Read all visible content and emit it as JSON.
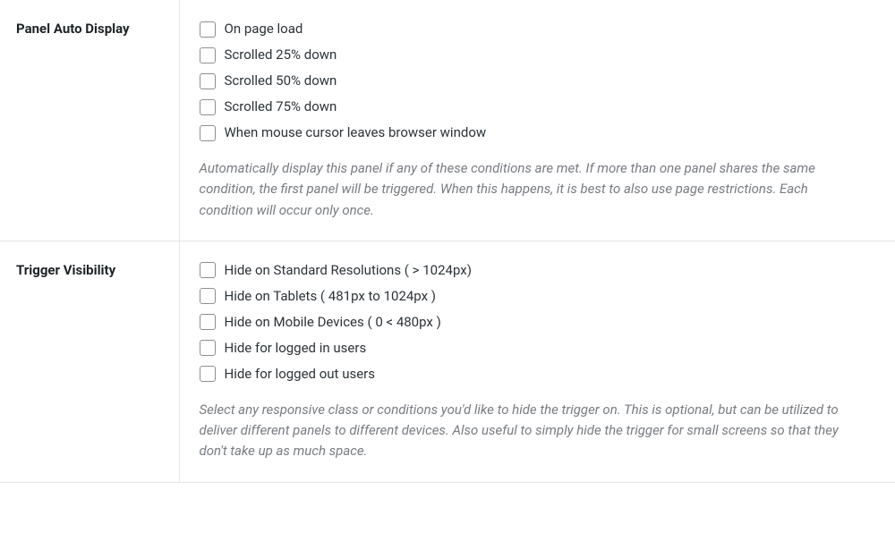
{
  "sections": {
    "autoDisplay": {
      "title": "Panel Auto Display",
      "options": {
        "o0": "On page load",
        "o1": "Scrolled 25% down",
        "o2": "Scrolled 50% down",
        "o3": "Scrolled 75% down",
        "o4": "When mouse cursor leaves browser window"
      },
      "description": "Automatically display this panel if any of these conditions are met. If more than one panel shares the same condition, the first panel will be triggered. When this happens, it is best to also use page restrictions. Each condition will occur only once."
    },
    "triggerVisibility": {
      "title": "Trigger Visibility",
      "options": {
        "o0": "Hide on Standard Resolutions ( > 1024px)",
        "o1": "Hide on Tablets ( 481px to 1024px )",
        "o2": "Hide on Mobile Devices ( 0 < 480px )",
        "o3": "Hide for logged in users",
        "o4": "Hide for logged out users"
      },
      "description": "Select any responsive class or conditions you'd like to hide the trigger on. This is optional, but can be utilized to deliver different panels to different devices. Also useful to simply hide the trigger for small screens so that they don't take up as much space."
    }
  }
}
